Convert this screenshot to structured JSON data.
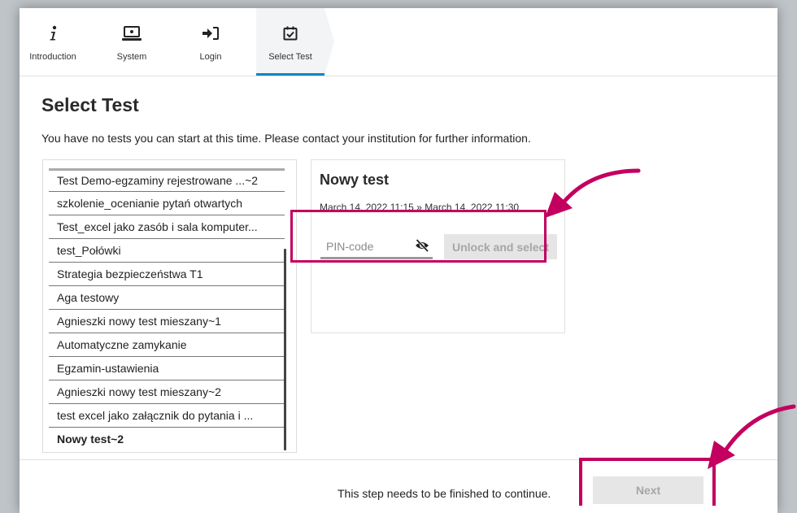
{
  "steps": [
    {
      "label": "Introduction",
      "icon": "info-icon"
    },
    {
      "label": "System",
      "icon": "laptop-icon"
    },
    {
      "label": "Login",
      "icon": "sign-in-icon"
    },
    {
      "label": "Select Test",
      "icon": "calendar-check-icon",
      "active": true
    }
  ],
  "page": {
    "title": "Select Test",
    "message": "You have no tests you can start at this time. Please contact your institution for further information."
  },
  "tests": [
    "Test Demo-egzaminy rejestrowane ...~2",
    "szkolenie_ocenianie pytań otwartych",
    "Test_excel jako zasób i sala komputer...",
    "test_Połówki",
    "Strategia bezpieczeństwa T1",
    "Aga testowy",
    "Agnieszki nowy test mieszany~1",
    "Automatyczne zamykanie",
    "Egzamin-ustawienia",
    "Agnieszki nowy test mieszany~2",
    "test excel jako załącznik do pytania i ...",
    "Nowy test~2"
  ],
  "selected_test_index": 11,
  "detail": {
    "title": "Nowy test",
    "time_range": "March 14, 2022 11:15 » March 14, 2022 11:30",
    "pin_placeholder": "PIN-code",
    "pin_value": "",
    "unlock_label": "Unlock and select"
  },
  "footer": {
    "message": "This step needs to be finished to continue.",
    "next_label": "Next"
  },
  "colors": {
    "accent": "#0a86c8",
    "highlight": "#c3005f",
    "disabled_text": "#a6a6a6"
  }
}
